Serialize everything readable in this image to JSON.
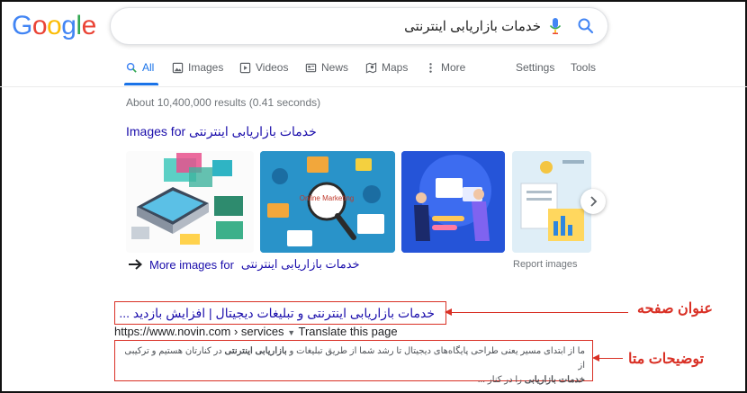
{
  "logo": {
    "letters": [
      "G",
      "o",
      "o",
      "g",
      "l",
      "e"
    ],
    "colors": [
      "#4285F4",
      "#EA4335",
      "#FBBC05",
      "#4285F4",
      "#34A853",
      "#EA4335"
    ]
  },
  "search": {
    "query": "خدمات بازاریابی اینترنتی"
  },
  "tabs": [
    {
      "label": "All",
      "icon": "search-icon",
      "active": true
    },
    {
      "label": "Images",
      "icon": "image-icon"
    },
    {
      "label": "Videos",
      "icon": "video-icon"
    },
    {
      "label": "News",
      "icon": "news-icon"
    },
    {
      "label": "Maps",
      "icon": "map-icon"
    },
    {
      "label": "More",
      "icon": "more-dots-icon"
    }
  ],
  "tools": {
    "settings": "Settings",
    "tools": "Tools"
  },
  "stats": "About 10,400,000 results (0.41 seconds)",
  "images_section": {
    "prefix": "Images for",
    "query": "خدمات بازاریابی اینترنتی",
    "more_label": "More images for",
    "report": "Report images",
    "thumb_texts": {
      "online_marketing": "Online Marketing"
    }
  },
  "result": {
    "title": "خدمات بازاریابی اینترنتی و تبلیغات دیجیتال | افزایش بازدید ...",
    "url": "https://www.novin.com › services",
    "translate": "Translate this page",
    "desc_line1_a": "ما از ابتدای مسیر یعنی طراحی پایگاه‌های دیجیتال تا رشد شما از طریق تبلیغات و ",
    "desc_line1_bold": "بازاریابی اینترنتی",
    "desc_line1_b": " در کنارتان هستیم و ترکیبی از",
    "desc_line2_bold": "خدمات بازاریابی",
    "desc_line2_b": " را در کنار ..."
  },
  "annotations": {
    "page_title": "عنوان  صفحه",
    "meta_description": "توضیحات  متا"
  },
  "colors": {
    "link": "#1a0dab",
    "accent": "#1a73e8",
    "annotation": "#d93025"
  }
}
